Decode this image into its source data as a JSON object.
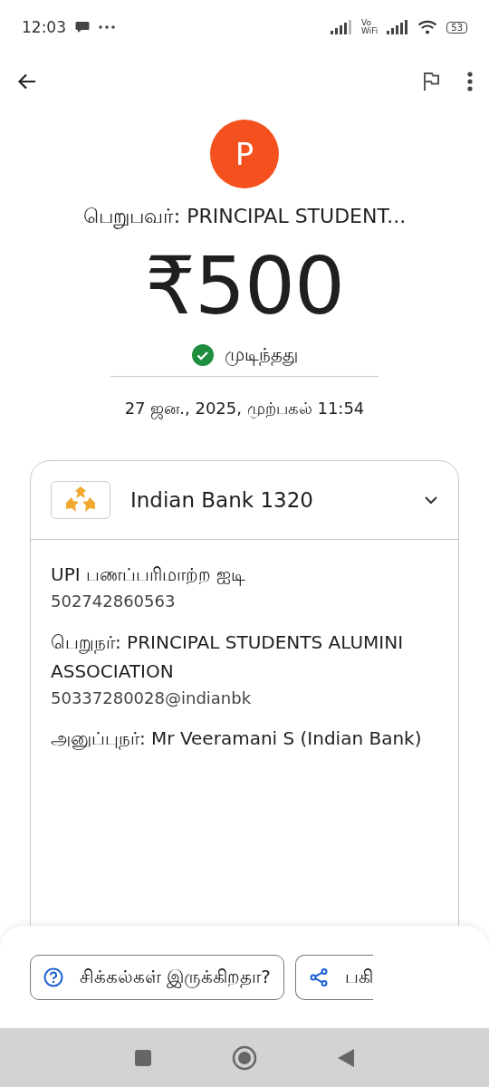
{
  "status_bar": {
    "time": "12:03",
    "network_label": "Vo\nWiFi",
    "battery": "53"
  },
  "payee_initial": "P",
  "payee": "பெறுபவர்: PRINCIPAL STUDENT...",
  "amount": "₹500",
  "status": {
    "label": "முடிந்தது",
    "kind": "completed"
  },
  "date": "27 ஜன., 2025, முற்பகல் 11:54",
  "account": {
    "name": "Indian Bank 1320",
    "expanded": false
  },
  "details": [
    {
      "label": "UPI பணப்பரிமாற்ற ஐடி",
      "value": "502742860563"
    },
    {
      "label": "பெறுநர்: PRINCIPAL STUDENTS ALUMINI ASSOCIATION",
      "value": "50337280028@indianbk"
    },
    {
      "label": "அனுப்புநர்: Mr Veeramani S (Indian Bank)"
    }
  ],
  "actions": [
    {
      "label": "சிக்கல்கள் இருக்கிறதா?",
      "kind": "help"
    },
    {
      "label": "பகி",
      "kind": "share"
    }
  ]
}
